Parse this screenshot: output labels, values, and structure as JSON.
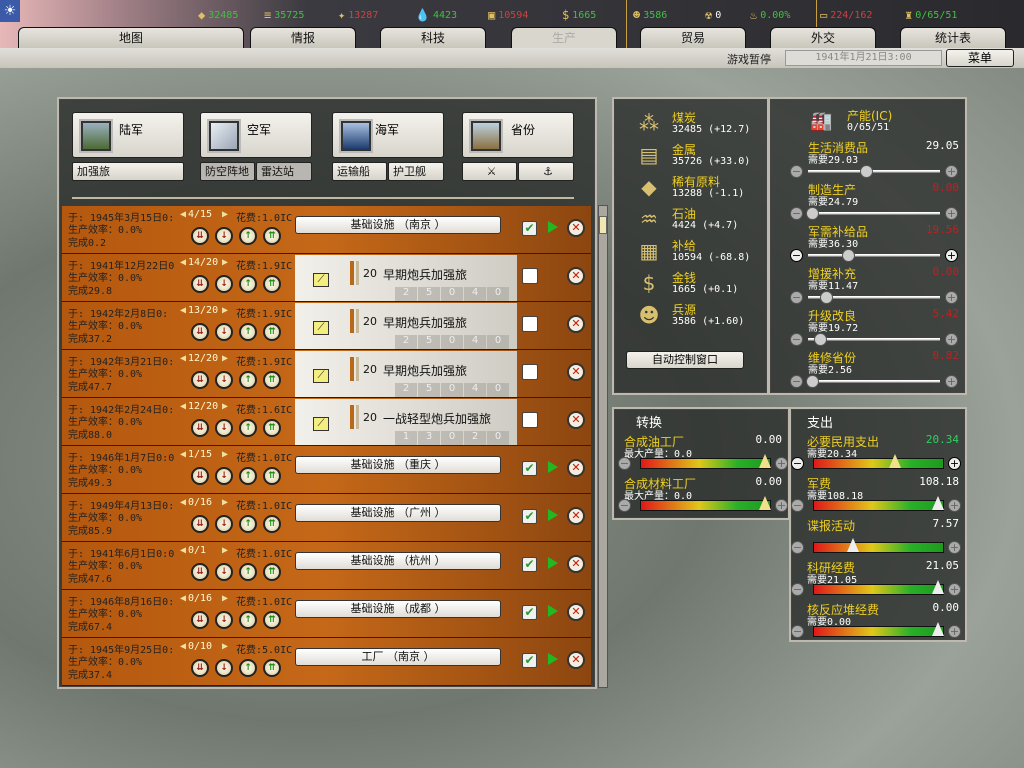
{
  "topbar": {
    "resources": [
      {
        "icon": "coal-icon",
        "glyph": "◆",
        "value": "32485",
        "color": "#40c040"
      },
      {
        "icon": "metal-icon",
        "glyph": "≡",
        "value": "35725",
        "color": "#40c040"
      },
      {
        "icon": "rare-materials-icon",
        "glyph": "✦",
        "value": "13287",
        "color": "#d04040"
      },
      {
        "icon": "oil-icon",
        "glyph": "💧",
        "value": "4423",
        "color": "#40c040"
      },
      {
        "icon": "supplies-icon",
        "glyph": "▣",
        "value": "10594",
        "color": "#d04040"
      },
      {
        "icon": "money-icon",
        "glyph": "$",
        "value": "1665",
        "color": "#40c040"
      },
      {
        "icon": "manpower-icon",
        "glyph": "☻",
        "value": "3586",
        "color": "#40c040"
      },
      {
        "icon": "nuclear-icon",
        "glyph": "☢",
        "value": "0",
        "color": "#ffffff"
      },
      {
        "icon": "dissent-icon",
        "glyph": "♨",
        "value": "0.00%",
        "color": "#40c040"
      },
      {
        "icon": "transport-icon",
        "glyph": "▭",
        "value": "224/162",
        "color": "#d04040"
      },
      {
        "icon": "ic-icon",
        "glyph": "♜",
        "value": "0/65/51",
        "color": "#40c040"
      }
    ],
    "tabs": [
      "地图",
      "情报",
      "科技",
      "生产",
      "贸易",
      "外交",
      "统计表"
    ],
    "paused": "游戏暂停",
    "date": "1941年1月21日3:00",
    "menu": "菜单"
  },
  "categories": {
    "army": "陆军",
    "air": "空军",
    "navy": "海军",
    "province": "省份",
    "brigade": "加强旅",
    "aa": "防空阵地",
    "radar": "雷达站",
    "transport": "运输船",
    "escort": "护卫舰",
    "fort_glyph": "⚔",
    "anchor_glyph": "⚓"
  },
  "queue": [
    {
      "line1": "于: 1945年3月15日0:",
      "count": "4/15",
      "cost": "花费:1.0IC",
      "eff": "生产效率：0.0%",
      "done": "完成0.2",
      "type": "build",
      "name": "基础设施 （南京 ）",
      "checked": true
    },
    {
      "line1": "于: 1941年12月22日0",
      "count": "14/20",
      "cost": "花费:1.9IC",
      "eff": "生产效率：0.0%",
      "done": "完成29.8",
      "type": "unit",
      "name": "早期炮兵加强旅",
      "qty": "20",
      "stats": [
        "2",
        "5",
        "0",
        "4",
        "0"
      ],
      "checked": false
    },
    {
      "line1": "于: 1942年2月8日0:",
      "count": "13/20",
      "cost": "花费:1.9IC",
      "eff": "生产效率：0.0%",
      "done": "完成37.2",
      "type": "unit",
      "name": "早期炮兵加强旅",
      "qty": "20",
      "stats": [
        "2",
        "5",
        "0",
        "4",
        "0"
      ],
      "checked": false
    },
    {
      "line1": "于: 1942年3月21日0:",
      "count": "12/20",
      "cost": "花费:1.9IC",
      "eff": "生产效率：0.0%",
      "done": "完成47.7",
      "type": "unit",
      "name": "早期炮兵加强旅",
      "qty": "20",
      "stats": [
        "2",
        "5",
        "0",
        "4",
        "0"
      ],
      "checked": false
    },
    {
      "line1": "于: 1942年2月24日0:",
      "count": "12/20",
      "cost": "花费:1.6IC",
      "eff": "生产效率：0.0%",
      "done": "完成88.0",
      "type": "unit",
      "name": "一战轻型炮兵加强旅",
      "qty": "20",
      "stats": [
        "1",
        "3",
        "0",
        "2",
        "0"
      ],
      "checked": false
    },
    {
      "line1": "于: 1946年1月7日0:0",
      "count": "1/15",
      "cost": "花费:1.0IC",
      "eff": "生产效率：0.0%",
      "done": "完成49.3",
      "type": "build",
      "name": "基础设施 （重庆 ）",
      "checked": true
    },
    {
      "line1": "于: 1949年4月13日0:",
      "count": "0/16",
      "cost": "花费:1.0IC",
      "eff": "生产效率：0.0%",
      "done": "完成85.9",
      "type": "build",
      "name": "基础设施 （广州 ）",
      "checked": true
    },
    {
      "line1": "于: 1941年6月1日0:0",
      "count": "0/1",
      "cost": "花费:1.0IC",
      "eff": "生产效率：0.0%",
      "done": "完成47.6",
      "type": "build",
      "name": "基础设施 （杭州 ）",
      "checked": true
    },
    {
      "line1": "于: 1946年8月16日0:",
      "count": "0/16",
      "cost": "花费:1.0IC",
      "eff": "生产效率：0.0%",
      "done": "完成67.4",
      "type": "build",
      "name": "基础设施 （成都 ）",
      "checked": true
    },
    {
      "line1": "于: 1945年9月25日0:",
      "count": "0/10",
      "cost": "花费:5.0IC",
      "eff": "生产效率：0.0%",
      "done": "完成37.4",
      "type": "build",
      "name": "工厂 （南京 ）",
      "checked": true
    }
  ],
  "stockpile": [
    {
      "icon": "coal-icon",
      "glyph": "⁂",
      "name": "煤炭",
      "value": "32485 (+12.7)"
    },
    {
      "icon": "metal-icon",
      "glyph": "▤",
      "name": "金属",
      "value": "35726 (+33.0)"
    },
    {
      "icon": "rare-materials-icon",
      "glyph": "◆",
      "name": "稀有原料",
      "value": "13288 (-1.1)"
    },
    {
      "icon": "oil-icon",
      "glyph": "♒",
      "name": "石油",
      "value": "4424 (+4.7)"
    },
    {
      "icon": "supplies-icon",
      "glyph": "▦",
      "name": "补给",
      "value": "10594 (-68.8)"
    },
    {
      "icon": "money-icon",
      "glyph": "$",
      "name": "金钱",
      "value": "1665 (+0.1)"
    },
    {
      "icon": "manpower-icon",
      "glyph": "☻",
      "name": "兵源",
      "value": "3586 (+1.60)"
    }
  ],
  "auto_control": "自动控制窗口",
  "ic": {
    "title": "产能(IC)",
    "value": "0/65/51",
    "sliders": [
      {
        "name": "生活消费品",
        "need": "需要29.03",
        "value": "29.05",
        "color": "#ffffff",
        "pos": 0.45
      },
      {
        "name": "制造生产",
        "need": "需要24.79",
        "value": "0.00",
        "color": "#c02020",
        "pos": 0.0
      },
      {
        "name": "军需补给品",
        "need": "需要36.30",
        "value": "19.56",
        "color": "#c02020",
        "pos": 0.3
      },
      {
        "name": "增援补充",
        "need": "需要11.47",
        "value": "0.00",
        "color": "#c02020",
        "pos": 0.12
      },
      {
        "name": "升级改良",
        "need": "需要19.72",
        "value": "5.42",
        "color": "#c02020",
        "pos": 0.07
      },
      {
        "name": "维修省份",
        "need": "需要2.56",
        "value": "0.82",
        "color": "#c02020",
        "pos": 0.0
      }
    ]
  },
  "conversion": {
    "title": "转换",
    "items": [
      {
        "name": "合成油工厂",
        "need": "最大产量：0.0",
        "value": "0.00",
        "pos": 1.0
      },
      {
        "name": "合成材料工厂",
        "need": "最大产量：0.0",
        "value": "0.00",
        "pos": 1.0
      }
    ]
  },
  "expenses": {
    "title": "支出",
    "items": [
      {
        "name": "必要民用支出",
        "need": "需要20.34",
        "value": "20.34",
        "color": "#30d060",
        "pos": 0.65
      },
      {
        "name": "军费",
        "need": "需要108.18",
        "value": "108.18",
        "color": "#ffffff",
        "pos": 1.0
      },
      {
        "name": "谍报活动",
        "need": "",
        "value": "7.57",
        "color": "#ffffff",
        "pos": 0.3
      },
      {
        "name": "科研经费",
        "need": "需要21.05",
        "value": "21.05",
        "color": "#ffffff",
        "pos": 1.0
      },
      {
        "name": "核反应堆经费",
        "need": "需要0.00",
        "value": "0.00",
        "color": "#ffffff",
        "pos": 1.0
      }
    ]
  }
}
